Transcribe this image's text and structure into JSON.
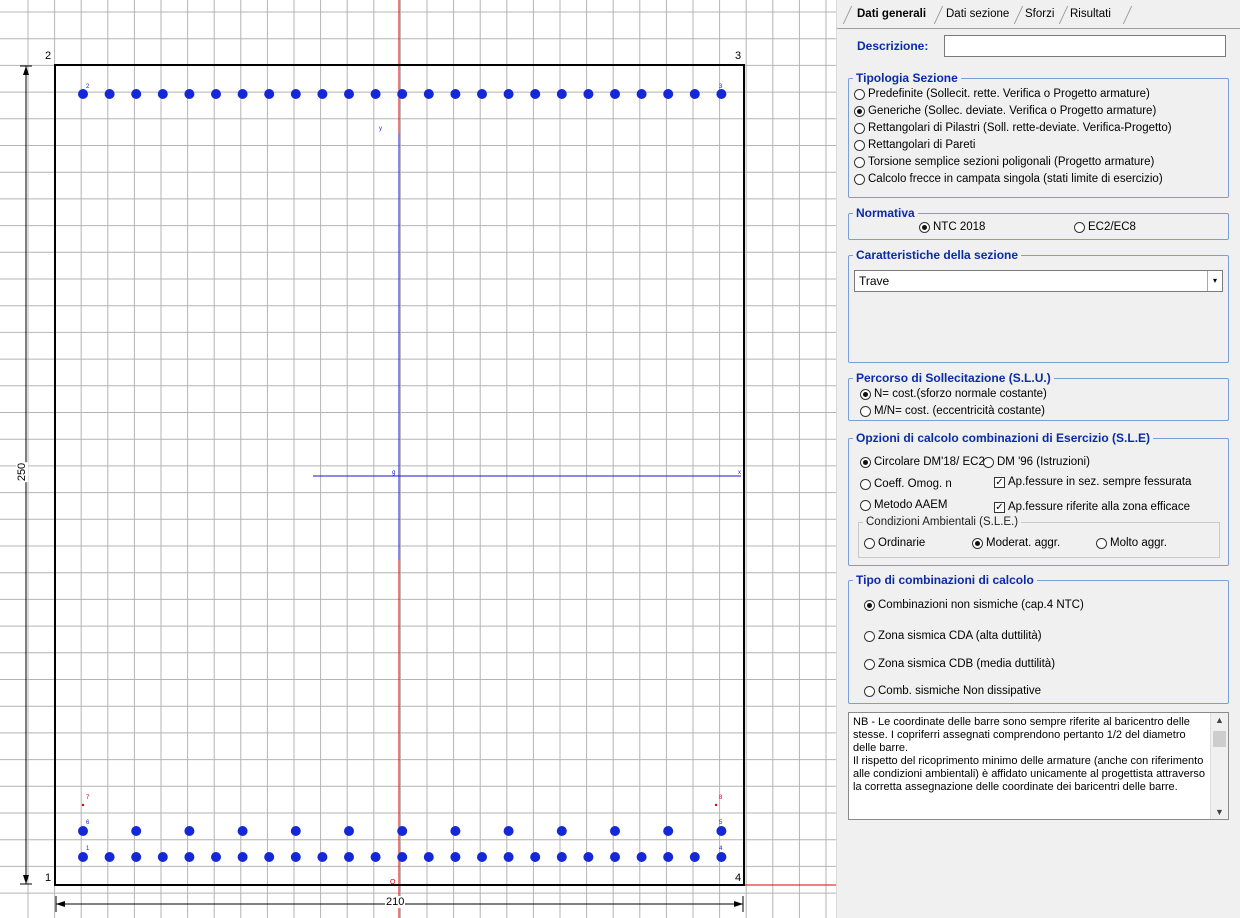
{
  "canvas": {
    "corner_labels": [
      "1",
      "2",
      "3",
      "4"
    ],
    "dim_height": "250",
    "dim_width": "210",
    "axis_labels": {
      "y_top": "y",
      "x_right": "x",
      "origin_g": "g",
      "origin_o": "O"
    },
    "bar_labels": {
      "b1": "1",
      "b2": "2",
      "b3": "3",
      "b4": "4",
      "b5": "5",
      "b6": "6",
      "b7": "7",
      "b8": "8"
    },
    "colors": {
      "grid": "#b4b4b4",
      "section": "#000000",
      "bars": "#1428d8",
      "axes_red": "#e00000",
      "axes_blue": "#1a1ad0",
      "labels_red": "#e00000"
    }
  },
  "tabs": [
    {
      "label": "Dati generali",
      "active": true
    },
    {
      "label": "Dati sezione",
      "active": false
    },
    {
      "label": "Sforzi",
      "active": false
    },
    {
      "label": "Risultati",
      "active": false
    }
  ],
  "descrizione": {
    "label": "Descrizione:",
    "value": ""
  },
  "tipologia": {
    "title": "Tipologia Sezione",
    "options": [
      {
        "label": "Predefinite (Sollecit. rette. Verifica o Progetto armature)",
        "selected": false
      },
      {
        "label": "Generiche (Sollec. deviate. Verifica o Progetto armature)",
        "selected": true
      },
      {
        "label": "Rettangolari di Pilastri (Soll. rette-deviate. Verifica-Progetto)",
        "selected": false
      },
      {
        "label": "Rettangolari di Pareti",
        "selected": false
      },
      {
        "label": "Torsione semplice sezioni poligonali (Progetto armature)",
        "selected": false
      },
      {
        "label": "Calcolo frecce in campata singola (stati limite di esercizio)",
        "selected": false
      }
    ]
  },
  "normativa": {
    "title": "Normativa",
    "options": [
      {
        "label": "NTC 2018",
        "selected": true
      },
      {
        "label": "EC2/EC8",
        "selected": false
      }
    ]
  },
  "caratteristiche": {
    "title": "Caratteristiche della sezione",
    "selected": "Trave"
  },
  "percorso": {
    "title": "Percorso di Sollecitazione (S.L.U.)",
    "options": [
      {
        "label": "N= cost.(sforzo normale costante)",
        "selected": true
      },
      {
        "label": "M/N= cost. (eccentricità costante)",
        "selected": false
      }
    ]
  },
  "opzioni_sle": {
    "title": "Opzioni di calcolo combinazioni di Esercizio (S.L.E)",
    "radio_circolare": "Circolare DM'18/ EC2",
    "radio_dm96": "DM '96 (Istruzioni)",
    "radio_coeff": "Coeff. Omog. n",
    "radio_aaem": "Metodo  AAEM",
    "check_fessurata": "Ap.fessure in sez. sempre fessurata",
    "check_efficace": "Ap.fessure riferite alla zona efficace",
    "ambientali": {
      "title": "Condizioni Ambientali (S.L.E.)",
      "options": [
        {
          "label": "Ordinarie",
          "selected": false
        },
        {
          "label": "Moderat. aggr.",
          "selected": true
        },
        {
          "label": "Molto aggr.",
          "selected": false
        }
      ]
    }
  },
  "tipo_comb": {
    "title": "Tipo di combinazioni di calcolo",
    "options": [
      {
        "label": "Combinazioni  non sismiche (cap.4  NTC)",
        "selected": true
      },
      {
        "label": "Zona sismica CDA (alta duttilità)",
        "selected": false
      },
      {
        "label": "Zona sismica CDB (media duttilità)",
        "selected": false
      },
      {
        "label": "Comb. sismiche Non dissipative",
        "selected": false
      }
    ]
  },
  "notes": {
    "lines": [
      "NB - Le coordinate delle barre sono sempre riferite al baricentro delle stesse.  I copriferri assegnati comprendono pertanto 1/2 del diametro delle barre.",
      "Il rispetto del ricoprimento minimo delle armature (anche con riferimento alle condizioni ambientali) è affidato unicamente al progettista attraverso la corretta assegnazione delle coordinate dei baricentri delle barre."
    ]
  }
}
